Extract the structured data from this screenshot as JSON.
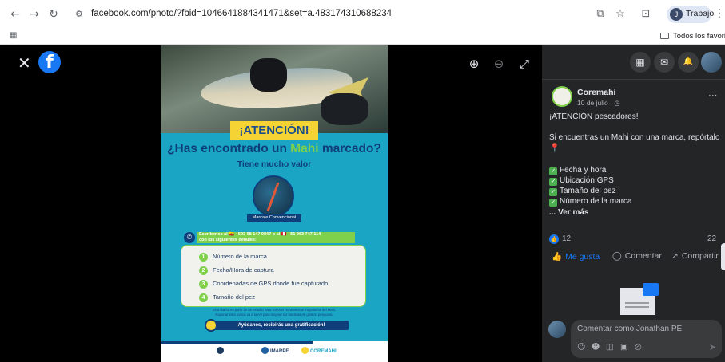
{
  "browser": {
    "url": "facebook.com/photo/?fbid=1046641884341471&set=a.483174310688234",
    "profile_name": "Trabajo",
    "profile_initial": "J",
    "bookmarks_folder": "Todos los favoritos",
    "icons": {
      "back": "←",
      "forward": "→",
      "reload": "↻",
      "site_info": "⚙",
      "cast": "⧉",
      "star": "☆",
      "extensions": "⊡",
      "menu": "⋮",
      "apps": "▦"
    }
  },
  "viewer": {
    "close": "✕",
    "fb_logo": "f",
    "zoom_in": "⊕",
    "zoom_out": "⊖",
    "fullscreen": "⤢"
  },
  "poster": {
    "atencion": "¡ATENCIÓN!",
    "question_pre": "¿Has encontrado un ",
    "question_mahi": "Mahi",
    "question_post": " marcado?",
    "subtitle": "Tiene mucho valor",
    "tag": "Marcaje Convencional",
    "whatsapp_line1": "Escríbenos al 🇪🇨 +593 98 147 0847 o al 🇵🇪 +51 963 747 114",
    "whatsapp_line2": "con los siguientes detalles:",
    "items": [
      {
        "n": "1",
        "text": "Número de la marca"
      },
      {
        "n": "2",
        "text": "Fecha/Hora de captura"
      },
      {
        "n": "3",
        "text": "Coordenadas de GPS donde fue capturado"
      },
      {
        "n": "4",
        "text": "Tamaño del pez"
      }
    ],
    "fine_print_1": "Esta marca es parte de un estudio para conocer movimientos migratorios del Mahi.",
    "fine_print_2": "Reportar esta marca va a servir para mejorar las medidas de gestión pesquera.",
    "gratification": "¡Ayúdanos, recibirás una gratificación!",
    "logos": [
      "IMARPE",
      "COREMAHI"
    ]
  },
  "panel": {
    "header_icons": {
      "apps": "▦",
      "messenger": "✉",
      "notifications": "🔔"
    },
    "page_name": "Coremahi",
    "post_date": "10 de julio · ◷",
    "more": "···",
    "text_headline": "¡ATENCIÓN pescadores!",
    "text_body": "Si encuentras un Mahi con una marca, repórtalo",
    "pin": "📍",
    "checklist": [
      "Fecha y hora",
      "Ubicación GPS",
      "Tamaño del pez",
      "Número de la marca"
    ],
    "see_more": "... Ver más",
    "likes": "12",
    "shares": "22",
    "like_label": "Me gusta",
    "comment_label": "Comentar",
    "share_label": "Compartir",
    "comment_placeholder": "Comentar como Jonathan PE",
    "comment_tools": [
      "☺",
      "☻",
      "◫",
      "▣",
      "◎"
    ],
    "send": "➤",
    "colors": {
      "background": "#242526",
      "accent": "#1877f2",
      "text": "#e4e6eb",
      "muted": "#b0b3b8"
    }
  }
}
